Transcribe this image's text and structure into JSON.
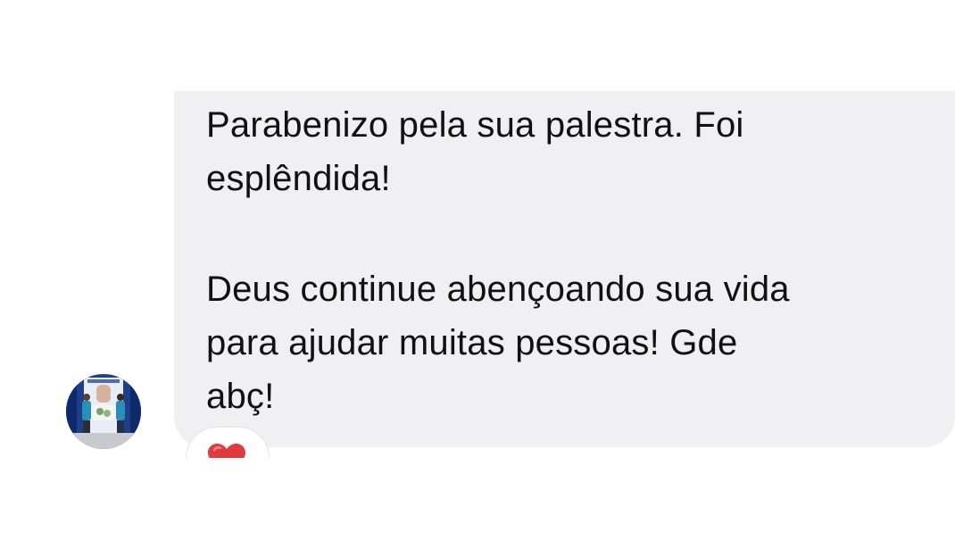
{
  "message": {
    "paragraph_1": "Parabenizo pela sua palestra. Foi\nesplêndida!",
    "paragraph_2": "Deus continue abençoando sua vida\npara ajudar muitas pessoas! Gde\nabç!"
  },
  "reaction": {
    "icon": "heart-icon",
    "color": "#e0393e"
  },
  "colors": {
    "bubble": "#f0f0f2",
    "text": "#111111",
    "background": "#ffffff"
  }
}
